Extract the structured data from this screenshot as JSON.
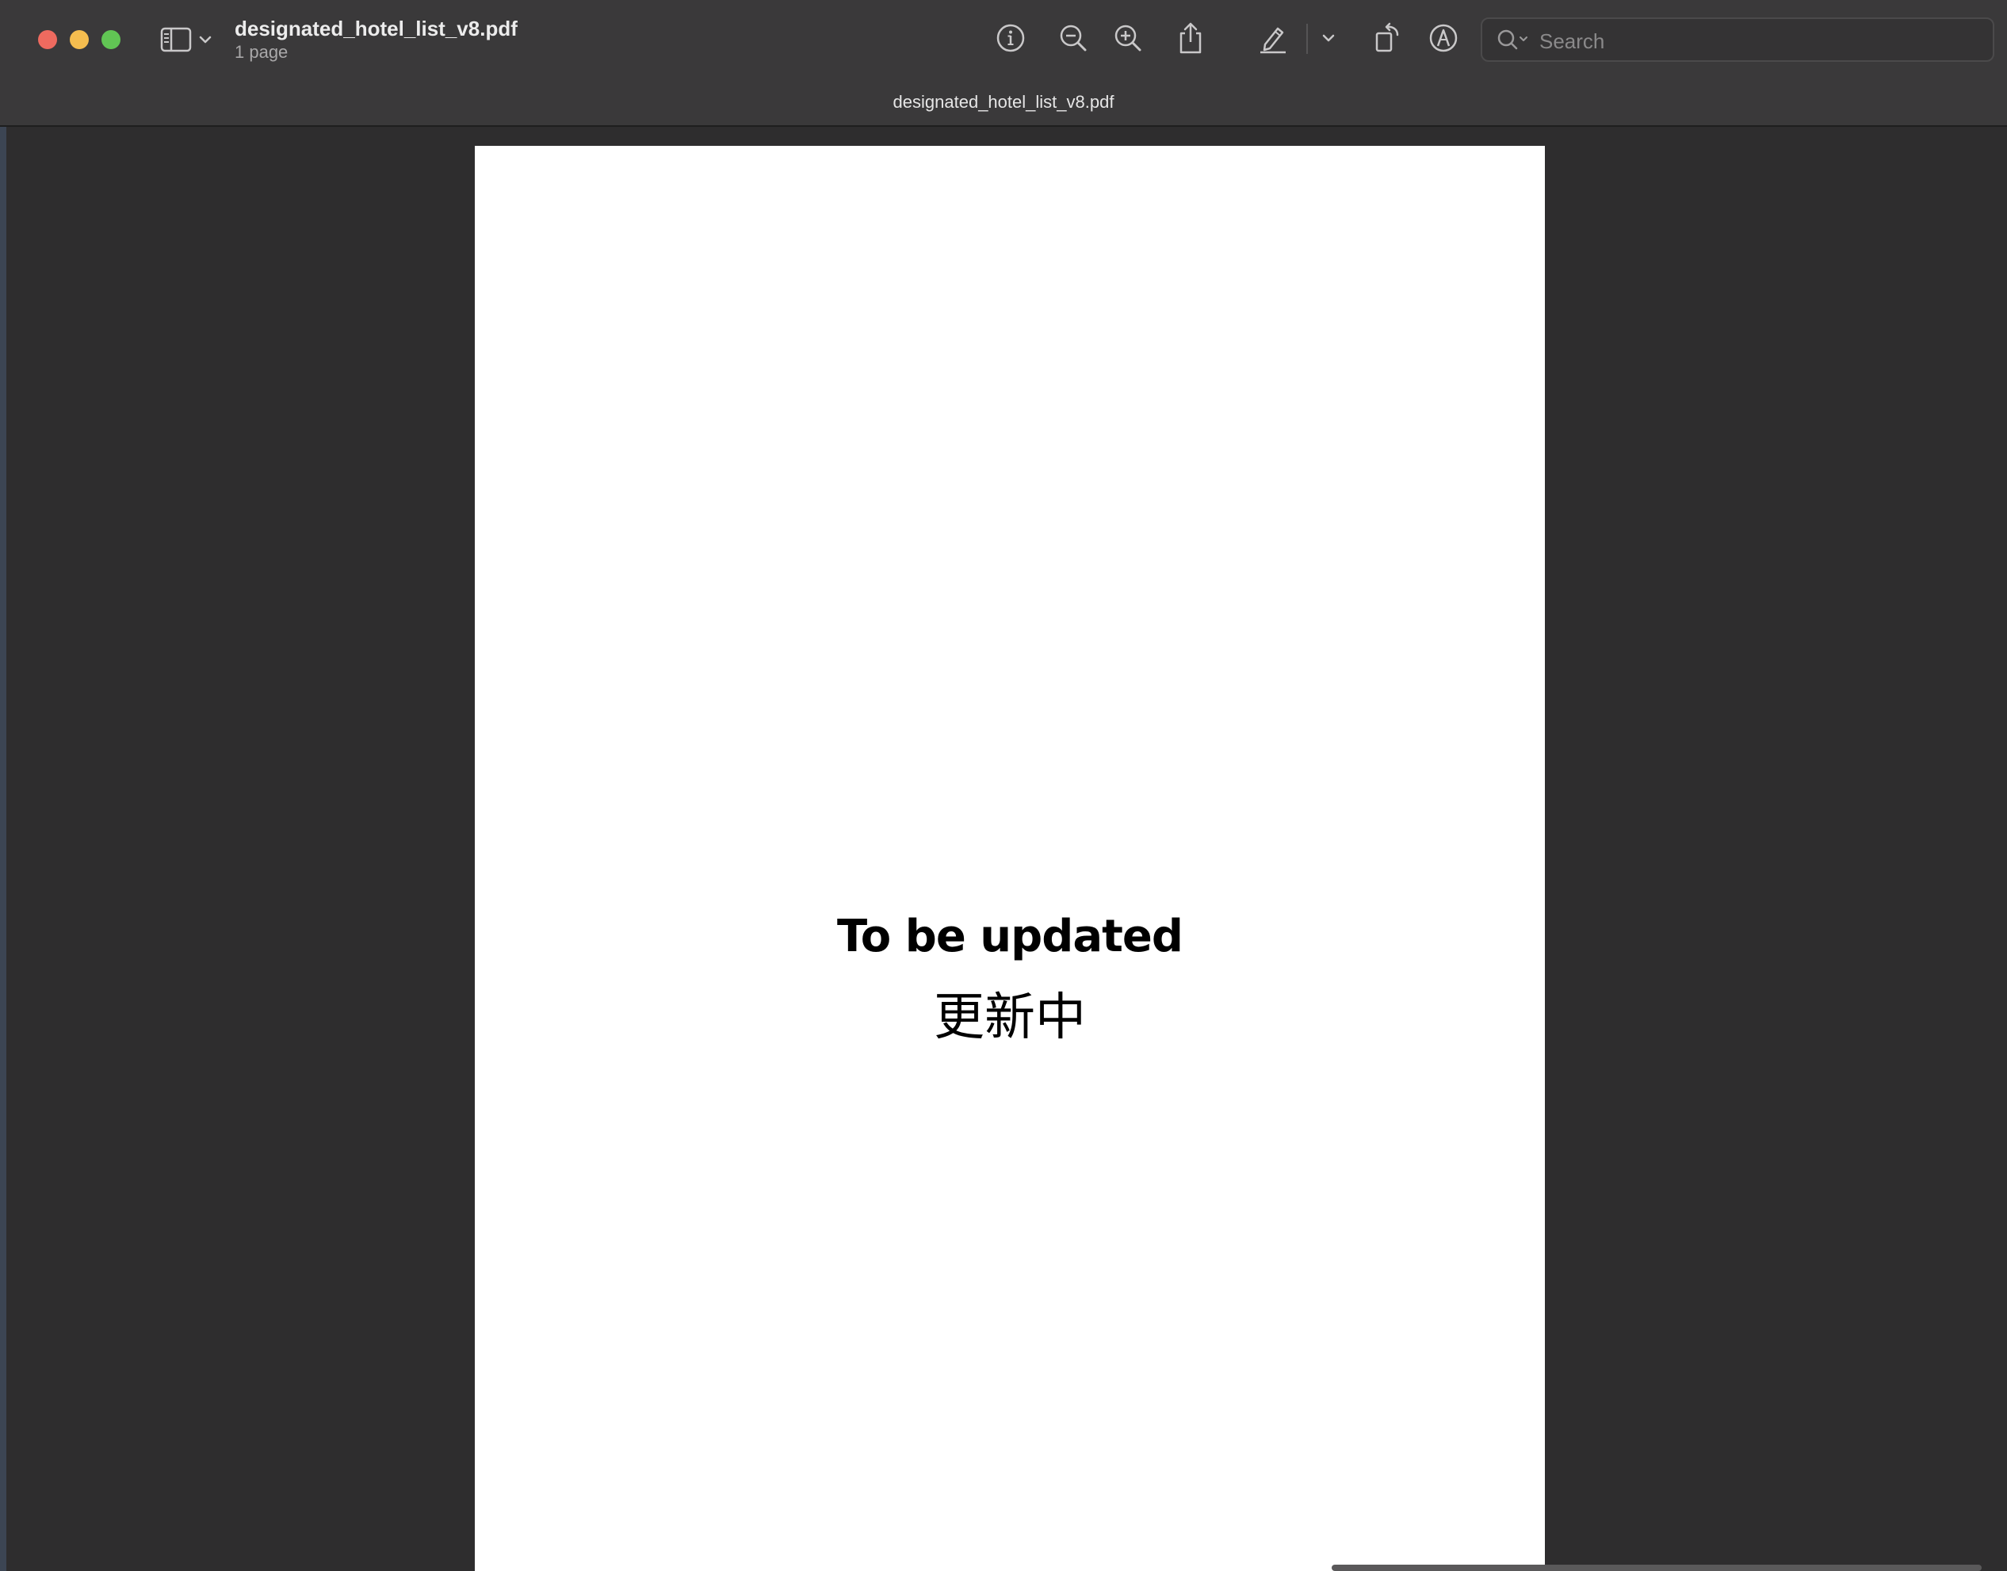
{
  "window": {
    "file_name": "designated_hotel_list_v8.pdf",
    "page_count": "1 page",
    "tab_title": "designated_hotel_list_v8.pdf"
  },
  "toolbar": {
    "icons": [
      "sidebar-icon",
      "chevron-down-icon",
      "info-icon",
      "zoom-out-icon",
      "zoom-in-icon",
      "share-icon",
      "highlight-pen-icon",
      "chevron-down-icon",
      "rotate-icon",
      "markup-icon"
    ]
  },
  "search": {
    "placeholder": "Search",
    "value": ""
  },
  "page": {
    "heading": "To be updated",
    "subheading": "更新中"
  },
  "colors": {
    "toolbar_bg": "#3a393a",
    "content_bg": "#2e2d2e",
    "close": "#ee6a5f",
    "minimize": "#f5bd4f",
    "maximize": "#61c554"
  }
}
